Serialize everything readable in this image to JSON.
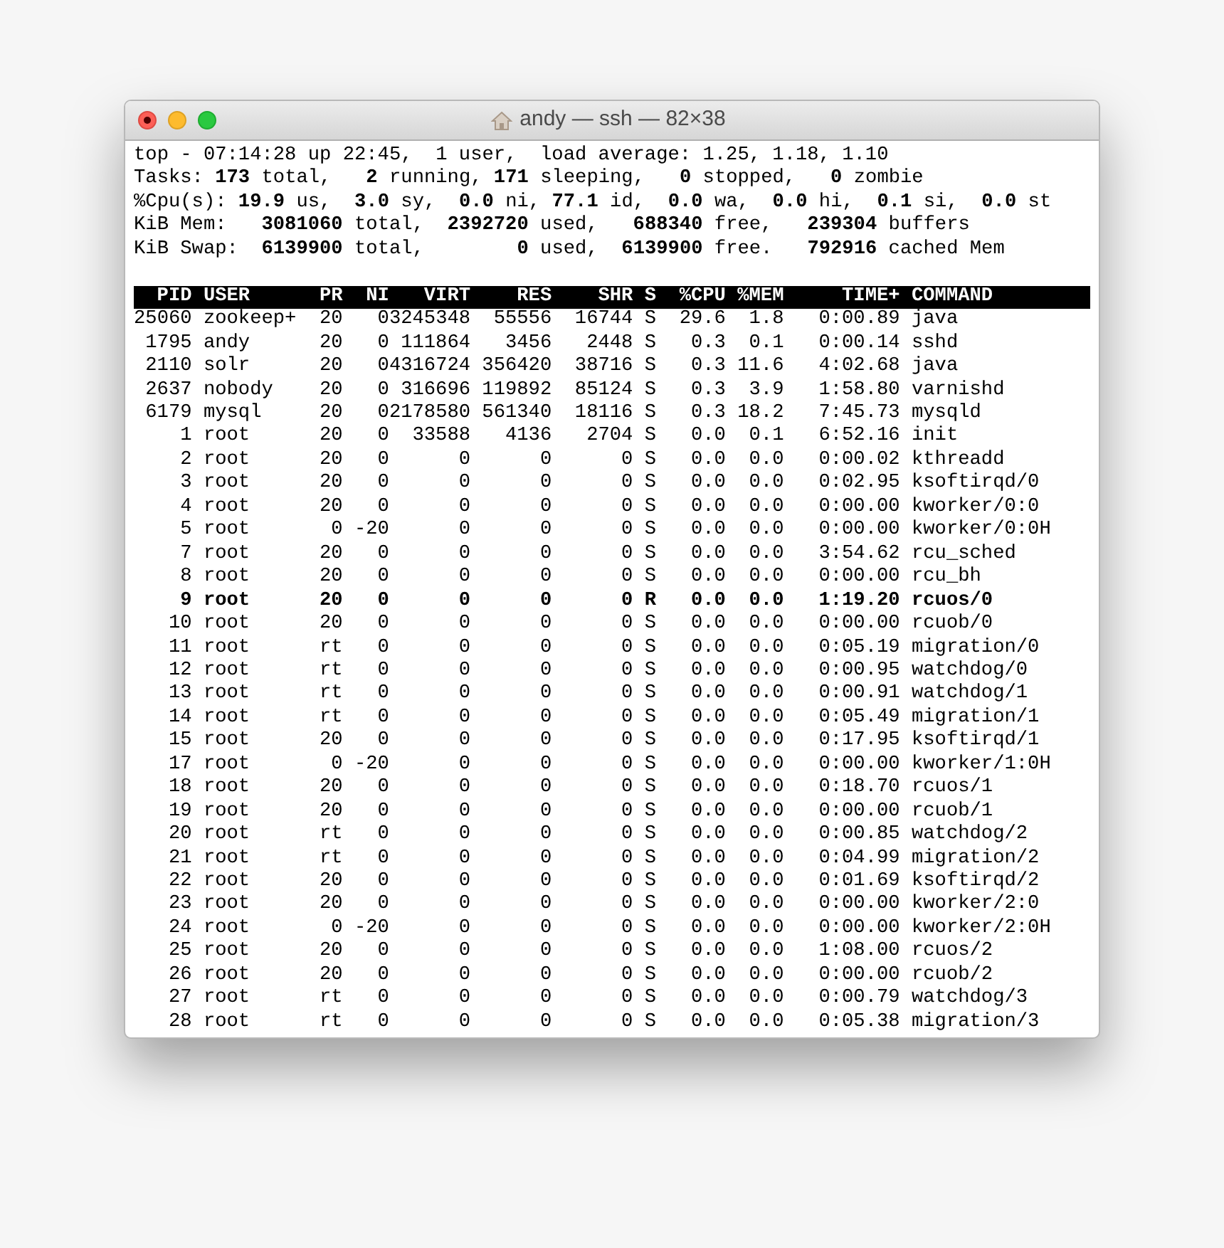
{
  "window": {
    "title": "andy — ssh — 82×38"
  },
  "summary": [
    "top - 07:14:28 up 22:45,  1 user,  load average: 1.25, 1.18, 1.10",
    "Tasks: **173** total,   **2** running, **171** sleeping,   **0** stopped,   **0** zombie",
    "%Cpu(s): **19.9** us,  **3.0** sy,  **0.0** ni, **77.1** id,  **0.0** wa,  **0.0** hi,  **0.1** si,  **0.0** st",
    "KiB Mem:   **3081060** total,  **2392720** used,   **688340** free,   **239304** buffers",
    "KiB Swap:  **6139900** total,        **0** used,  **6139900** free.   **792916** cached Mem"
  ],
  "columns": [
    "PID",
    "USER",
    "PR",
    "NI",
    "VIRT",
    "RES",
    "SHR",
    "S",
    "%CPU",
    "%MEM",
    "TIME+",
    "COMMAND"
  ],
  "rows": [
    {
      "bold": false,
      "cells": [
        "25060",
        "zookeep+",
        "20",
        "0",
        "3245348",
        "55556",
        "16744",
        "S",
        "29.6",
        "1.8",
        "0:00.89",
        "java"
      ]
    },
    {
      "bold": false,
      "cells": [
        "1795",
        "andy",
        "20",
        "0",
        "111864",
        "3456",
        "2448",
        "S",
        "0.3",
        "0.1",
        "0:00.14",
        "sshd"
      ]
    },
    {
      "bold": false,
      "cells": [
        "2110",
        "solr",
        "20",
        "0",
        "4316724",
        "356420",
        "38716",
        "S",
        "0.3",
        "11.6",
        "4:02.68",
        "java"
      ]
    },
    {
      "bold": false,
      "cells": [
        "2637",
        "nobody",
        "20",
        "0",
        "316696",
        "119892",
        "85124",
        "S",
        "0.3",
        "3.9",
        "1:58.80",
        "varnishd"
      ]
    },
    {
      "bold": false,
      "cells": [
        "6179",
        "mysql",
        "20",
        "0",
        "2178580",
        "561340",
        "18116",
        "S",
        "0.3",
        "18.2",
        "7:45.73",
        "mysqld"
      ]
    },
    {
      "bold": false,
      "cells": [
        "1",
        "root",
        "20",
        "0",
        "33588",
        "4136",
        "2704",
        "S",
        "0.0",
        "0.1",
        "6:52.16",
        "init"
      ]
    },
    {
      "bold": false,
      "cells": [
        "2",
        "root",
        "20",
        "0",
        "0",
        "0",
        "0",
        "S",
        "0.0",
        "0.0",
        "0:00.02",
        "kthreadd"
      ]
    },
    {
      "bold": false,
      "cells": [
        "3",
        "root",
        "20",
        "0",
        "0",
        "0",
        "0",
        "S",
        "0.0",
        "0.0",
        "0:02.95",
        "ksoftirqd/0"
      ]
    },
    {
      "bold": false,
      "cells": [
        "4",
        "root",
        "20",
        "0",
        "0",
        "0",
        "0",
        "S",
        "0.0",
        "0.0",
        "0:00.00",
        "kworker/0:0"
      ]
    },
    {
      "bold": false,
      "cells": [
        "5",
        "root",
        "0",
        "-20",
        "0",
        "0",
        "0",
        "S",
        "0.0",
        "0.0",
        "0:00.00",
        "kworker/0:0H"
      ]
    },
    {
      "bold": false,
      "cells": [
        "7",
        "root",
        "20",
        "0",
        "0",
        "0",
        "0",
        "S",
        "0.0",
        "0.0",
        "3:54.62",
        "rcu_sched"
      ]
    },
    {
      "bold": false,
      "cells": [
        "8",
        "root",
        "20",
        "0",
        "0",
        "0",
        "0",
        "S",
        "0.0",
        "0.0",
        "0:00.00",
        "rcu_bh"
      ]
    },
    {
      "bold": true,
      "cells": [
        "9",
        "root",
        "20",
        "0",
        "0",
        "0",
        "0",
        "R",
        "0.0",
        "0.0",
        "1:19.20",
        "rcuos/0"
      ]
    },
    {
      "bold": false,
      "cells": [
        "10",
        "root",
        "20",
        "0",
        "0",
        "0",
        "0",
        "S",
        "0.0",
        "0.0",
        "0:00.00",
        "rcuob/0"
      ]
    },
    {
      "bold": false,
      "cells": [
        "11",
        "root",
        "rt",
        "0",
        "0",
        "0",
        "0",
        "S",
        "0.0",
        "0.0",
        "0:05.19",
        "migration/0"
      ]
    },
    {
      "bold": false,
      "cells": [
        "12",
        "root",
        "rt",
        "0",
        "0",
        "0",
        "0",
        "S",
        "0.0",
        "0.0",
        "0:00.95",
        "watchdog/0"
      ]
    },
    {
      "bold": false,
      "cells": [
        "13",
        "root",
        "rt",
        "0",
        "0",
        "0",
        "0",
        "S",
        "0.0",
        "0.0",
        "0:00.91",
        "watchdog/1"
      ]
    },
    {
      "bold": false,
      "cells": [
        "14",
        "root",
        "rt",
        "0",
        "0",
        "0",
        "0",
        "S",
        "0.0",
        "0.0",
        "0:05.49",
        "migration/1"
      ]
    },
    {
      "bold": false,
      "cells": [
        "15",
        "root",
        "20",
        "0",
        "0",
        "0",
        "0",
        "S",
        "0.0",
        "0.0",
        "0:17.95",
        "ksoftirqd/1"
      ]
    },
    {
      "bold": false,
      "cells": [
        "17",
        "root",
        "0",
        "-20",
        "0",
        "0",
        "0",
        "S",
        "0.0",
        "0.0",
        "0:00.00",
        "kworker/1:0H"
      ]
    },
    {
      "bold": false,
      "cells": [
        "18",
        "root",
        "20",
        "0",
        "0",
        "0",
        "0",
        "S",
        "0.0",
        "0.0",
        "0:18.70",
        "rcuos/1"
      ]
    },
    {
      "bold": false,
      "cells": [
        "19",
        "root",
        "20",
        "0",
        "0",
        "0",
        "0",
        "S",
        "0.0",
        "0.0",
        "0:00.00",
        "rcuob/1"
      ]
    },
    {
      "bold": false,
      "cells": [
        "20",
        "root",
        "rt",
        "0",
        "0",
        "0",
        "0",
        "S",
        "0.0",
        "0.0",
        "0:00.85",
        "watchdog/2"
      ]
    },
    {
      "bold": false,
      "cells": [
        "21",
        "root",
        "rt",
        "0",
        "0",
        "0",
        "0",
        "S",
        "0.0",
        "0.0",
        "0:04.99",
        "migration/2"
      ]
    },
    {
      "bold": false,
      "cells": [
        "22",
        "root",
        "20",
        "0",
        "0",
        "0",
        "0",
        "S",
        "0.0",
        "0.0",
        "0:01.69",
        "ksoftirqd/2"
      ]
    },
    {
      "bold": false,
      "cells": [
        "23",
        "root",
        "20",
        "0",
        "0",
        "0",
        "0",
        "S",
        "0.0",
        "0.0",
        "0:00.00",
        "kworker/2:0"
      ]
    },
    {
      "bold": false,
      "cells": [
        "24",
        "root",
        "0",
        "-20",
        "0",
        "0",
        "0",
        "S",
        "0.0",
        "0.0",
        "0:00.00",
        "kworker/2:0H"
      ]
    },
    {
      "bold": false,
      "cells": [
        "25",
        "root",
        "20",
        "0",
        "0",
        "0",
        "0",
        "S",
        "0.0",
        "0.0",
        "1:08.00",
        "rcuos/2"
      ]
    },
    {
      "bold": false,
      "cells": [
        "26",
        "root",
        "20",
        "0",
        "0",
        "0",
        "0",
        "S",
        "0.0",
        "0.0",
        "0:00.00",
        "rcuob/2"
      ]
    },
    {
      "bold": false,
      "cells": [
        "27",
        "root",
        "rt",
        "0",
        "0",
        "0",
        "0",
        "S",
        "0.0",
        "0.0",
        "0:00.79",
        "watchdog/3"
      ]
    },
    {
      "bold": false,
      "cells": [
        "28",
        "root",
        "rt",
        "0",
        "0",
        "0",
        "0",
        "S",
        "0.0",
        "0.0",
        "0:05.38",
        "migration/3"
      ]
    }
  ]
}
